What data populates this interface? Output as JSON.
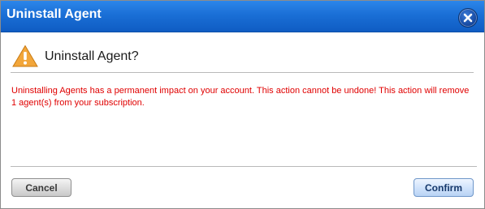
{
  "dialog": {
    "title": "Uninstall Agent",
    "close_icon": "close-icon",
    "header": {
      "icon": "warning-icon",
      "title": "Uninstall Agent?"
    },
    "message": "Uninstalling Agents has a permanent impact on your account. This action cannot be undone! This action will remove 1 agent(s) from your subscription.",
    "buttons": {
      "cancel": "Cancel",
      "confirm": "Confirm"
    }
  },
  "colors": {
    "titlebar": "#1a6fd6",
    "message_text": "#e00000",
    "warning_icon": "#f2a63a"
  }
}
